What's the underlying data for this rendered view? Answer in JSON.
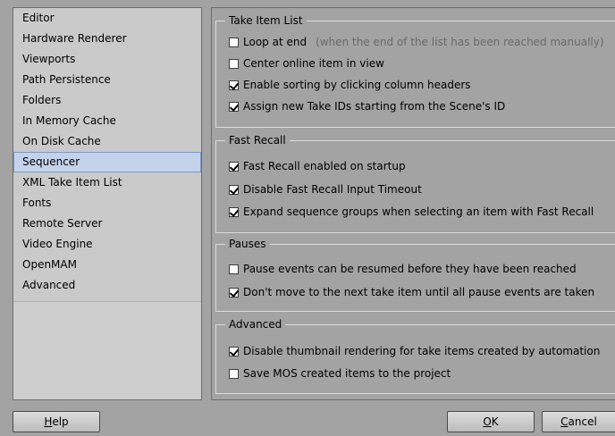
{
  "sidebar": {
    "items": [
      {
        "label": "Editor"
      },
      {
        "label": "Hardware Renderer"
      },
      {
        "label": "Viewports"
      },
      {
        "label": "Path Persistence"
      },
      {
        "label": "Folders"
      },
      {
        "label": "In Memory Cache"
      },
      {
        "label": "On Disk Cache"
      },
      {
        "label": "Sequencer",
        "selected": true
      },
      {
        "label": "XML Take Item List"
      },
      {
        "label": "Fonts"
      },
      {
        "label": "Remote Server"
      },
      {
        "label": "Video Engine"
      },
      {
        "label": "OpenMAM"
      },
      {
        "label": "Advanced"
      }
    ]
  },
  "groups": {
    "take_item_list": {
      "title": "Take Item List",
      "options": [
        {
          "label": "Loop at end",
          "hint": "(when the end of the list has been reached manually)",
          "checked": false
        },
        {
          "label": "Center online item in view",
          "checked": false
        },
        {
          "label": "Enable sorting by clicking column headers",
          "checked": true
        },
        {
          "label": "Assign new Take IDs starting from the Scene's ID",
          "checked": true
        }
      ]
    },
    "fast_recall": {
      "title": "Fast Recall",
      "options": [
        {
          "label": "Fast Recall enabled on startup",
          "checked": true
        },
        {
          "label": "Disable Fast Recall Input Timeout",
          "checked": true
        },
        {
          "label": "Expand sequence groups when selecting an item with Fast Recall",
          "checked": true
        }
      ]
    },
    "pauses": {
      "title": "Pauses",
      "options": [
        {
          "label": "Pause events can be resumed before they have been reached",
          "checked": false
        },
        {
          "label": "Don't move to the next take item until all pause events are taken",
          "checked": true
        }
      ]
    },
    "advanced": {
      "title": "Advanced",
      "options": [
        {
          "label": "Disable thumbnail rendering for take items created by automation",
          "checked": true
        },
        {
          "label": "Save MOS created items to the project",
          "checked": false
        }
      ]
    }
  },
  "buttons": {
    "help": {
      "mnemonic": "H",
      "rest": "elp"
    },
    "ok": {
      "mnemonic": "O",
      "rest": "K"
    },
    "cancel": {
      "mnemonic": "C",
      "rest": "ancel"
    }
  }
}
